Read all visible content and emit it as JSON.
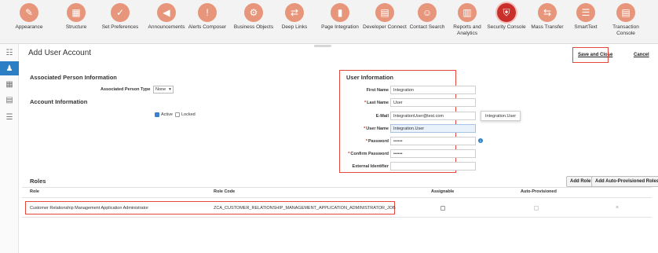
{
  "nav": [
    {
      "label": "Appearance",
      "icon": "brush-icon",
      "glyph": "✎"
    },
    {
      "label": "Structure",
      "icon": "structure-icon",
      "glyph": "▦"
    },
    {
      "label": "Set Preferences",
      "icon": "preferences-icon",
      "glyph": "✓"
    },
    {
      "label": "Announcements",
      "icon": "megaphone-icon",
      "glyph": "◀"
    },
    {
      "label": "Alerts Composer",
      "icon": "alert-icon",
      "glyph": "!"
    },
    {
      "label": "Business Objects",
      "icon": "objects-icon",
      "glyph": "⚙"
    },
    {
      "label": "Deep Links",
      "icon": "deep-links-icon",
      "glyph": "⇄"
    },
    {
      "label": "Page Integration",
      "icon": "page-integration-icon",
      "glyph": "▮"
    },
    {
      "label": "Developer Connect",
      "icon": "developer-connect-icon",
      "glyph": "▤"
    },
    {
      "label": "Contact Search",
      "icon": "contact-search-icon",
      "glyph": "☺"
    },
    {
      "label": "Reports and\nAnalytics",
      "icon": "reports-icon",
      "glyph": "▥"
    },
    {
      "label": "Security Console",
      "icon": "shield-icon",
      "glyph": "⛨",
      "active": true
    },
    {
      "label": "Mass Transfer",
      "icon": "mass-transfer-icon",
      "glyph": "⇆"
    },
    {
      "label": "SmartText",
      "icon": "smarttext-icon",
      "glyph": "☰"
    },
    {
      "label": "Transaction\nConsole",
      "icon": "transaction-console-icon",
      "glyph": "▤"
    }
  ],
  "rail": [
    {
      "icon": "users-icon",
      "glyph": "☷"
    },
    {
      "icon": "user-icon",
      "glyph": "♟",
      "active": true
    },
    {
      "icon": "roles-icon",
      "glyph": "▦"
    },
    {
      "icon": "analytics-icon",
      "glyph": "▤"
    },
    {
      "icon": "list-icon",
      "glyph": "☰"
    }
  ],
  "page": {
    "title": "Add User Account",
    "save_close": "Save and Close",
    "cancel": "Cancel"
  },
  "associated": {
    "heading": "Associated Person Information",
    "type_label": "Associated Person Type",
    "type_value": "None",
    "type_caret": "▾"
  },
  "account": {
    "heading": "Account Information",
    "active_label": "Active",
    "locked_label": "Locked"
  },
  "user_info": {
    "heading": "User Information",
    "required_mark": "*",
    "first_name_label": "First Name",
    "first_name": "Integration",
    "last_name_label": "Last Name",
    "last_name": "User",
    "email_label": "E-Mail",
    "email": "IntegrationUser@test.com",
    "username_label": "User Name",
    "username": "Integration.User",
    "tooltip": "Integration.User",
    "password_label": "Password",
    "password": "••••••",
    "info_glyph": "i",
    "confirm_label": "Confirm Password",
    "confirm": "••••••",
    "external_label": "External Identifier",
    "external": ""
  },
  "roles": {
    "heading": "Roles",
    "add_role": "Add Role",
    "add_auto": "Add Auto-Provisioned Roles",
    "columns": [
      "Role",
      "Role Code",
      "Assignable",
      "Auto-Provisioned"
    ],
    "rows": [
      {
        "role": "Customer Relationship Management Application Administrator",
        "code": "ZCA_CUSTOMER_RELATIONSHIP_MANAGEMENT_APPLICATION_ADMINISTRATOR_JOB",
        "remove": "×"
      }
    ]
  }
}
